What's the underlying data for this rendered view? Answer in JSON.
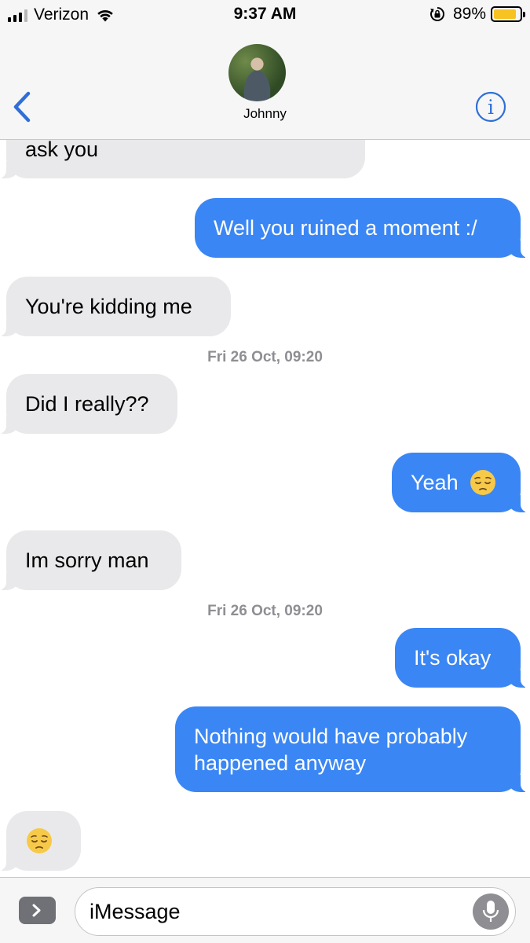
{
  "status_bar": {
    "carrier": "Verizon",
    "time": "9:37 AM",
    "battery_percent": "89%",
    "battery_level": 0.89,
    "battery_color": "#f6c322",
    "icons": [
      "signal-icon",
      "wifi-icon",
      "orientation-lock-icon",
      "battery-icon"
    ]
  },
  "header": {
    "contact_name": "Johnny",
    "back_icon": "chevron-left-icon",
    "info_icon": "info-icon",
    "accent_color": "#2f6fd6"
  },
  "messages": [
    {
      "direction": "incoming",
      "text": "ask you",
      "partial": true
    },
    {
      "direction": "outgoing",
      "text": "Well you ruined a moment :/"
    },
    {
      "direction": "incoming",
      "text": "You're kidding me"
    },
    {
      "type": "timestamp",
      "text": "Fri 26 Oct, 09:20"
    },
    {
      "direction": "incoming",
      "text": "Did I really??"
    },
    {
      "direction": "outgoing",
      "text": "Yeah",
      "emoji": "pensive-face"
    },
    {
      "direction": "incoming",
      "text": "Im sorry man"
    },
    {
      "type": "timestamp",
      "text": "Fri 26 Oct, 09:20"
    },
    {
      "direction": "outgoing",
      "text": "It's okay"
    },
    {
      "direction": "outgoing",
      "text": "Nothing would have probably\nhappened anyway"
    },
    {
      "direction": "incoming",
      "text": "",
      "emoji": "pensive-face"
    }
  ],
  "colors": {
    "outgoing_bubble": "#3a86f4",
    "incoming_bubble": "#e9e9eb",
    "timestamp": "#8e8e93"
  },
  "input_bar": {
    "placeholder": "iMessage",
    "apps_icon": "chevron-right-icon",
    "mic_icon": "microphone-icon"
  }
}
